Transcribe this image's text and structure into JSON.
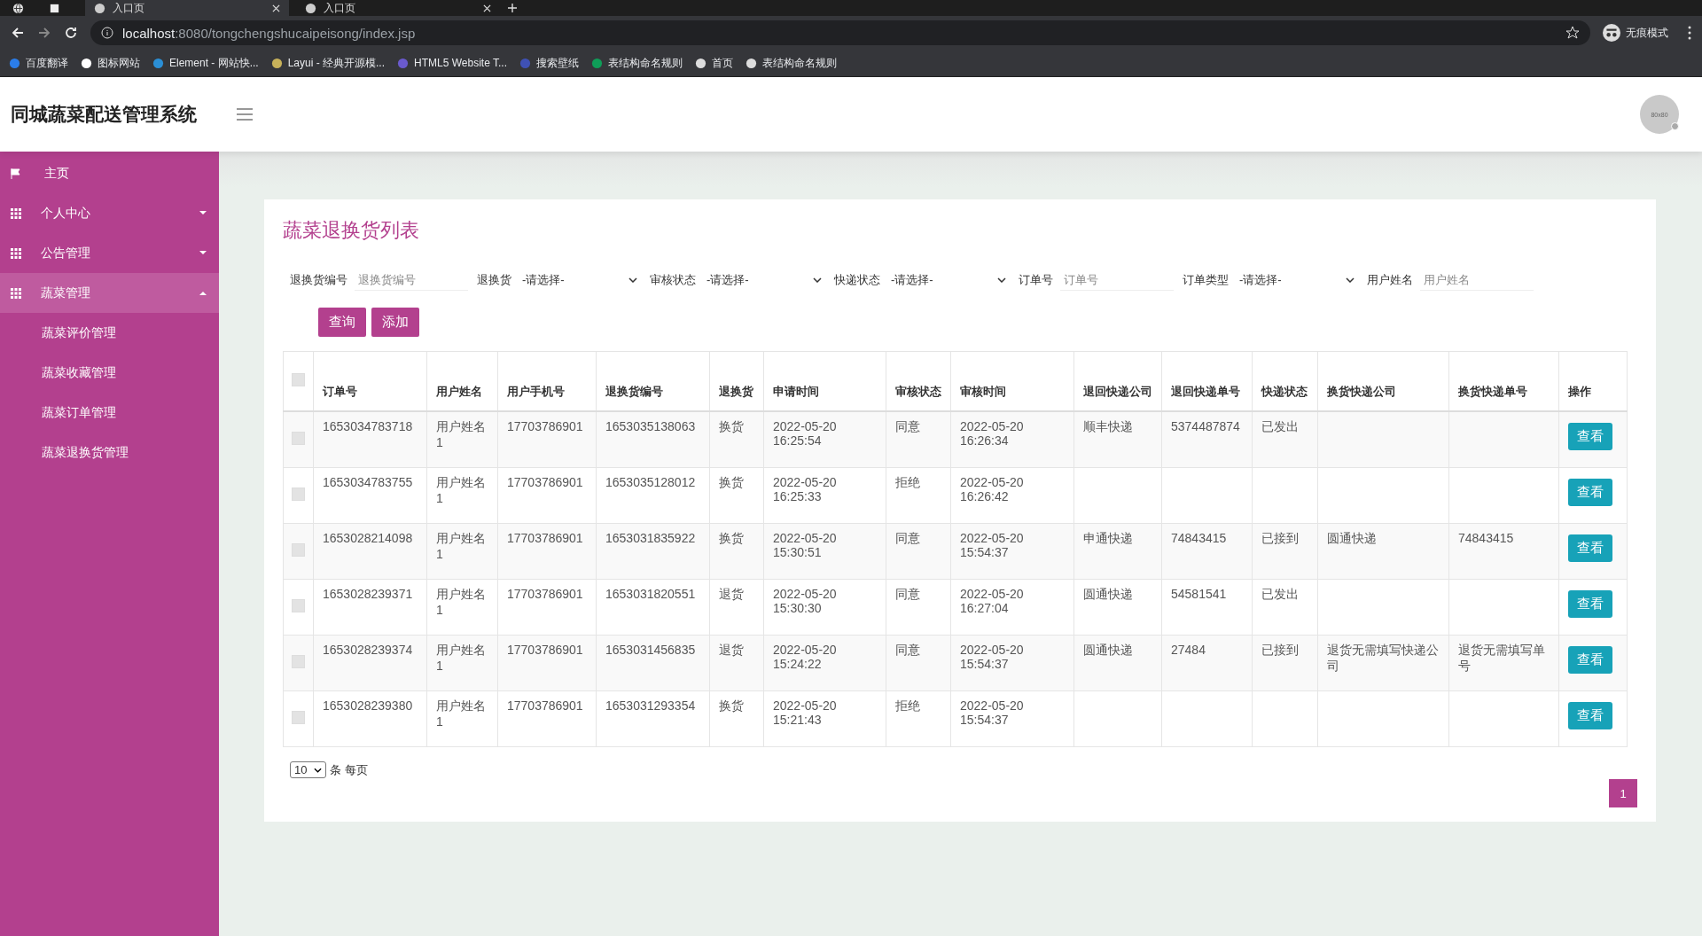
{
  "browser": {
    "tabs": [
      {
        "title": "入口页",
        "selected": true
      },
      {
        "title": "入口页",
        "selected": false
      }
    ],
    "url_host": "localhost",
    "url_path": ":8080/tongchengshucaipeisong/index.jsp",
    "incognito_label": "无痕模式",
    "bookmarks": [
      "百度翻译",
      "图标网站",
      "Element - 网站快...",
      "Layui - 经典开源模...",
      "HTML5 Website T...",
      "搜索壁纸",
      "表结构命名规则",
      "首页",
      "表结构命名规则"
    ]
  },
  "app": {
    "title": "同城蔬菜配送管理系统",
    "avatar_text": "80x80"
  },
  "sidebar": {
    "items": [
      {
        "label": "主页",
        "kind": "link",
        "selected": false
      },
      {
        "label": "个人中心",
        "kind": "group",
        "expanded": false,
        "selected": false
      },
      {
        "label": "公告管理",
        "kind": "group",
        "expanded": false,
        "selected": false
      },
      {
        "label": "蔬菜管理",
        "kind": "group",
        "expanded": true,
        "selected": true,
        "children": [
          {
            "label": "蔬菜评价管理"
          },
          {
            "label": "蔬菜收藏管理"
          },
          {
            "label": "蔬菜订单管理"
          },
          {
            "label": "蔬菜退换货管理"
          }
        ]
      }
    ]
  },
  "page": {
    "title": "蔬菜退换货列表",
    "filters": [
      {
        "label": "退换货编号",
        "kind": "text",
        "placeholder": "退换货编号"
      },
      {
        "label": "退换货",
        "kind": "select",
        "value": "-请选择-"
      },
      {
        "label": "审核状态",
        "kind": "select",
        "value": "-请选择-"
      },
      {
        "label": "快递状态",
        "kind": "select",
        "value": "-请选择-"
      },
      {
        "label": "订单号",
        "kind": "text",
        "placeholder": "订单号"
      },
      {
        "label": "订单类型",
        "kind": "select",
        "value": "-请选择-"
      },
      {
        "label": "用户姓名",
        "kind": "text",
        "placeholder": "用户姓名"
      }
    ],
    "buttons": [
      "查询",
      "添加"
    ],
    "table": {
      "select_all_checked": false,
      "columns": [
        {
          "label": "订单号",
          "kind": "text"
        },
        {
          "label": "用户姓名",
          "kind": "text"
        },
        {
          "label": "用户手机号",
          "kind": "text"
        },
        {
          "label": "退换货编号",
          "kind": "text"
        },
        {
          "label": "退换货",
          "kind": "text"
        },
        {
          "label": "申请时间",
          "kind": "text"
        },
        {
          "label": "审核状态",
          "kind": "text"
        },
        {
          "label": "审核时间",
          "kind": "text"
        },
        {
          "label": "退回快递公司",
          "kind": "text"
        },
        {
          "label": "退回快递单号",
          "kind": "text"
        },
        {
          "label": "快递状态",
          "kind": "text"
        },
        {
          "label": "换货快递公司",
          "kind": "text"
        },
        {
          "label": "换货快递单号",
          "kind": "text"
        },
        {
          "label": "操作",
          "kind": "action"
        }
      ],
      "rows": [
        {
          "checked": false,
          "cells": [
            "1653034783718",
            "用户姓名1",
            "17703786901",
            "1653035138063",
            "换货",
            "2022-05-20 16:25:54",
            "同意",
            "2022-05-20 16:26:34",
            "顺丰快递",
            "5374487874",
            "已发出",
            null,
            null,
            "查看"
          ]
        },
        {
          "checked": false,
          "cells": [
            "1653034783755",
            "用户姓名1",
            "17703786901",
            "1653035128012",
            "换货",
            "2022-05-20 16:25:33",
            "拒绝",
            "2022-05-20 16:26:42",
            null,
            null,
            null,
            null,
            null,
            "查看"
          ]
        },
        {
          "checked": false,
          "cells": [
            "1653028214098",
            "用户姓名1",
            "17703786901",
            "1653031835922",
            "换货",
            "2022-05-20 15:30:51",
            "同意",
            "2022-05-20 15:54:37",
            "申通快递",
            "74843415",
            "已接到",
            "圆通快递",
            "74843415",
            "查看"
          ]
        },
        {
          "checked": false,
          "cells": [
            "1653028239371",
            "用户姓名1",
            "17703786901",
            "1653031820551",
            "退货",
            "2022-05-20 15:30:30",
            "同意",
            "2022-05-20 16:27:04",
            "圆通快递",
            "54581541",
            "已发出",
            null,
            null,
            "查看"
          ]
        },
        {
          "checked": false,
          "cells": [
            "1653028239374",
            "用户姓名1",
            "17703786901",
            "1653031456835",
            "退货",
            "2022-05-20 15:24:22",
            "同意",
            "2022-05-20 15:54:37",
            "圆通快递",
            "27484",
            "已接到",
            "退货无需填写快递公司",
            "退货无需填写单号",
            "查看"
          ]
        },
        {
          "checked": false,
          "cells": [
            "1653028239380",
            "用户姓名1",
            "17703786901",
            "1653031293354",
            "换货",
            "2022-05-20 15:21:43",
            "拒绝",
            "2022-05-20 15:54:37",
            null,
            null,
            null,
            null,
            null,
            "查看"
          ]
        }
      ]
    },
    "pagination": {
      "page_size": "10",
      "per_page_label": "条 每页",
      "pages": [
        {
          "label": "1",
          "selected": true
        }
      ]
    }
  }
}
